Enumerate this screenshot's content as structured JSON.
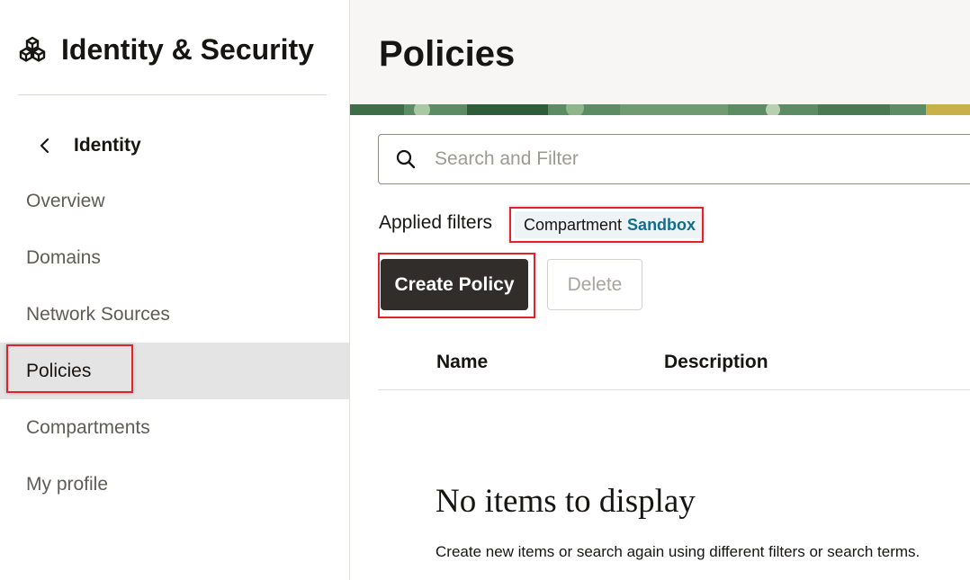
{
  "sidebar": {
    "brand_icon": "cubes-icon",
    "brand_title": "Identity & Security",
    "back_icon": "chevron-left-icon",
    "back_label": "Identity",
    "items": [
      {
        "label": "Overview",
        "active": false
      },
      {
        "label": "Domains",
        "active": false
      },
      {
        "label": "Network Sources",
        "active": false
      },
      {
        "label": "Policies",
        "active": true
      },
      {
        "label": "Compartments",
        "active": false
      },
      {
        "label": "My profile",
        "active": false
      }
    ]
  },
  "header": {
    "title": "Policies"
  },
  "search": {
    "icon": "search-icon",
    "placeholder": "Search and Filter",
    "value": ""
  },
  "filters": {
    "applied_label": "Applied filters",
    "chip_key": "Compartment",
    "chip_value": "Sandbox"
  },
  "actions": {
    "create_label": "Create Policy",
    "delete_label": "Delete"
  },
  "table": {
    "columns": [
      "Name",
      "Description"
    ]
  },
  "empty_state": {
    "title": "No items to display",
    "message": "Create new items or search again using different filters or search terms."
  },
  "colors": {
    "primary_button": "#312d2a",
    "highlight": "#e0242d",
    "chip_value": "#0e6f8f",
    "active_nav": "#e5e4e4"
  }
}
